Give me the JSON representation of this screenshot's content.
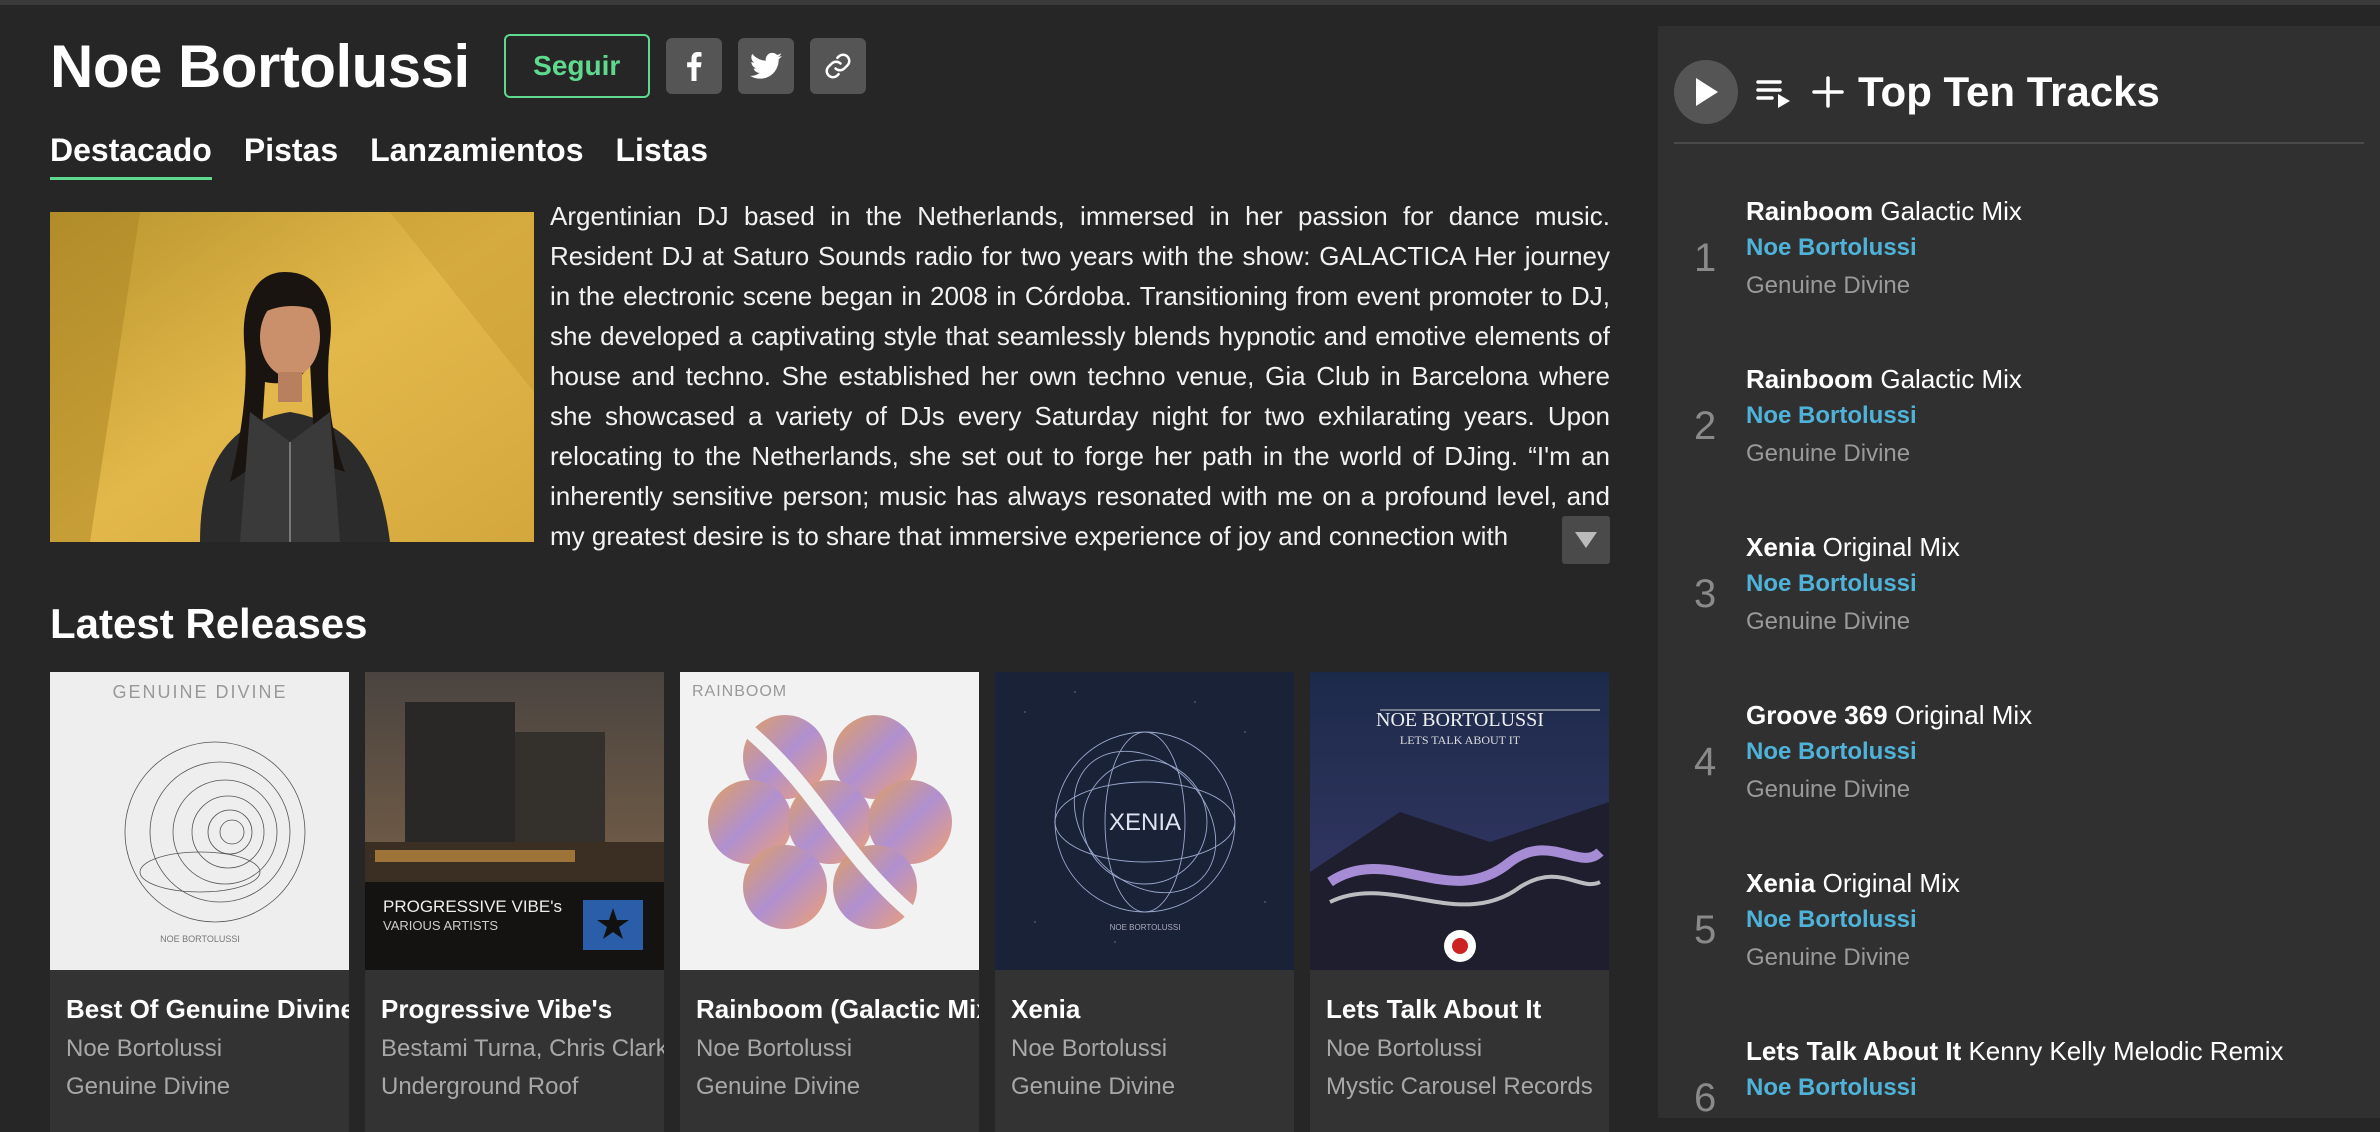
{
  "artist": {
    "name": "Noe Bortolussi",
    "follow_label": "Seguir"
  },
  "social": [
    "facebook-icon",
    "twitter-icon",
    "link-icon"
  ],
  "tabs": [
    {
      "label": "Destacado",
      "active": true
    },
    {
      "label": "Pistas",
      "active": false
    },
    {
      "label": "Lanzamientos",
      "active": false
    },
    {
      "label": "Listas",
      "active": false
    }
  ],
  "bio": "Argentinian DJ based in the Netherlands, immersed in her passion for dance music. Resident DJ at Saturo Sounds radio for two years with the show: GALACTICA Her journey in the electronic scene began in 2008 in Córdoba. Transitioning from event promoter to DJ, she developed a captivating style that seamlessly blends hypnotic and emotive elements of house and techno. She established her own techno venue, Gia Club in Barcelona where she showcased a variety of DJs every Saturday night for two exhilarating years. Upon relocating to the Netherlands, she set out to forge her path in the world of DJing. “I'm an inherently sensitive person; music has always resonated with me on a profound level, and my greatest desire is to share that immersive experience of joy and connection with",
  "latest_releases": {
    "title": "Latest Releases",
    "items": [
      {
        "title": "Best Of Genuine Divine",
        "artist": "Noe Bortolussi",
        "label": "Genuine Divine",
        "cover_text": "GENUINE DIVINE",
        "cover_sub": "NOE BORTOLUSSI"
      },
      {
        "title": "Progressive Vibe's",
        "artist": "Bestami Turna, Chris Clark",
        "label": "Underground Roof",
        "cover_text": "PROGRESSIVE VIBE's",
        "cover_sub": "VARIOUS ARTISTS"
      },
      {
        "title": "Rainboom (Galactic Mix)",
        "artist": "Noe Bortolussi",
        "label": "Genuine Divine",
        "cover_text": "RAINBOOM",
        "cover_sub": ""
      },
      {
        "title": "Xenia",
        "artist": "Noe Bortolussi",
        "label": "Genuine Divine",
        "cover_text": "XENIA",
        "cover_sub": "NOE BORTOLUSSI"
      },
      {
        "title": "Lets Talk About It",
        "artist": "Noe Bortolussi",
        "label": "Mystic Carousel Records",
        "cover_text": "NOE BORTOLUSSI",
        "cover_sub": "LETS TALK ABOUT IT"
      }
    ]
  },
  "top_tracks": {
    "title": "Top Ten Tracks",
    "items": [
      {
        "num": "1",
        "name": "Rainboom",
        "mix": "Galactic Mix",
        "artist": "Noe Bortolussi",
        "label": "Genuine Divine"
      },
      {
        "num": "2",
        "name": "Rainboom",
        "mix": "Galactic Mix",
        "artist": "Noe Bortolussi",
        "label": "Genuine Divine"
      },
      {
        "num": "3",
        "name": "Xenia",
        "mix": "Original Mix",
        "artist": "Noe Bortolussi",
        "label": "Genuine Divine"
      },
      {
        "num": "4",
        "name": "Groove 369",
        "mix": "Original Mix",
        "artist": "Noe Bortolussi",
        "label": "Genuine Divine"
      },
      {
        "num": "5",
        "name": "Xenia",
        "mix": "Original Mix",
        "artist": "Noe Bortolussi",
        "label": "Genuine Divine"
      },
      {
        "num": "6",
        "name": "Lets Talk About It",
        "mix": "Kenny Kelly Melodic Remix",
        "artist": "Noe Bortolussi",
        "label": ""
      }
    ]
  },
  "colors": {
    "accent_green": "#5fd98d",
    "link_blue": "#4fb3d9",
    "background": "#262626",
    "sidebar": "#303030"
  }
}
